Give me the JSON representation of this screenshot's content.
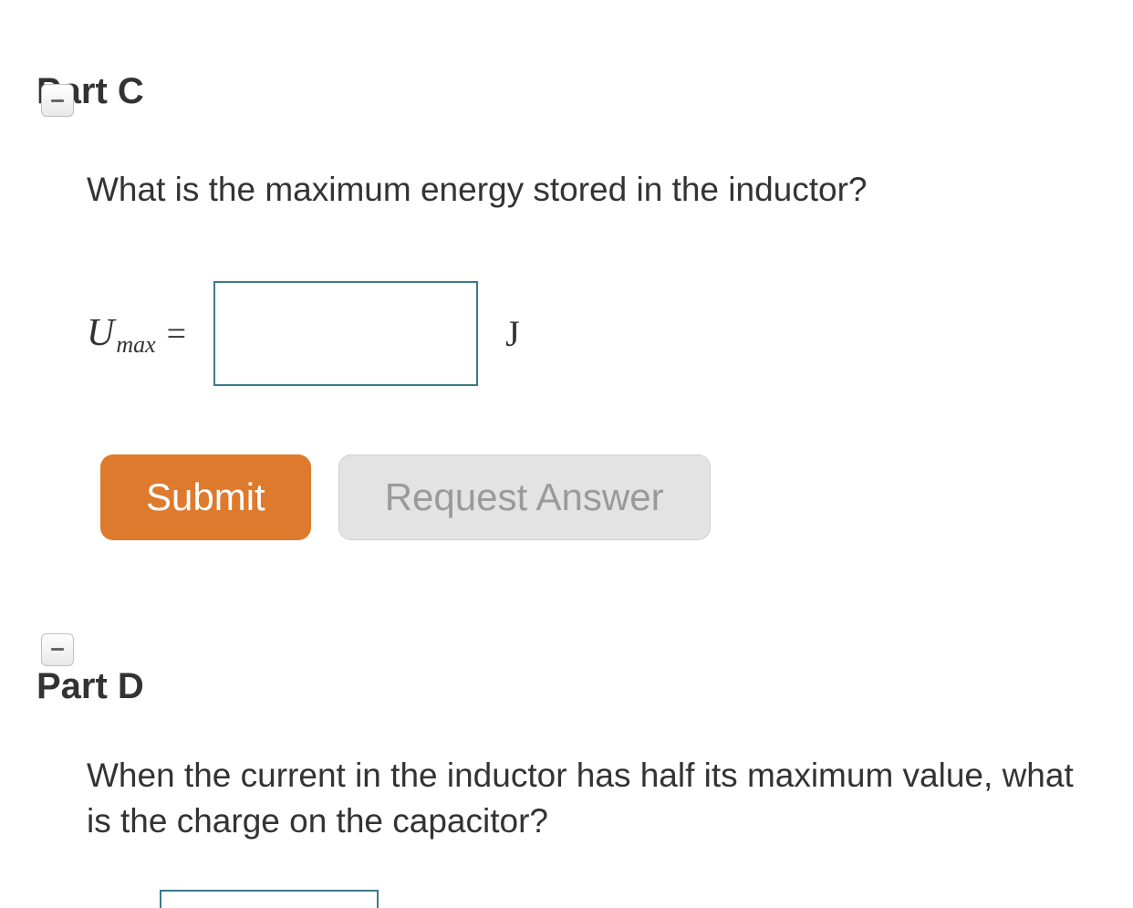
{
  "partC": {
    "title": "Part C",
    "question": "What is the maximum energy stored in the inductor?",
    "variable": {
      "main": "U",
      "sub": "max",
      "equals": "="
    },
    "input_value": "",
    "unit": "J",
    "buttons": {
      "submit": "Submit",
      "request": "Request Answer"
    }
  },
  "partD": {
    "title": "Part D",
    "question": "When the current in the inductor has half its maximum value, what is the charge on the capacitor?"
  }
}
